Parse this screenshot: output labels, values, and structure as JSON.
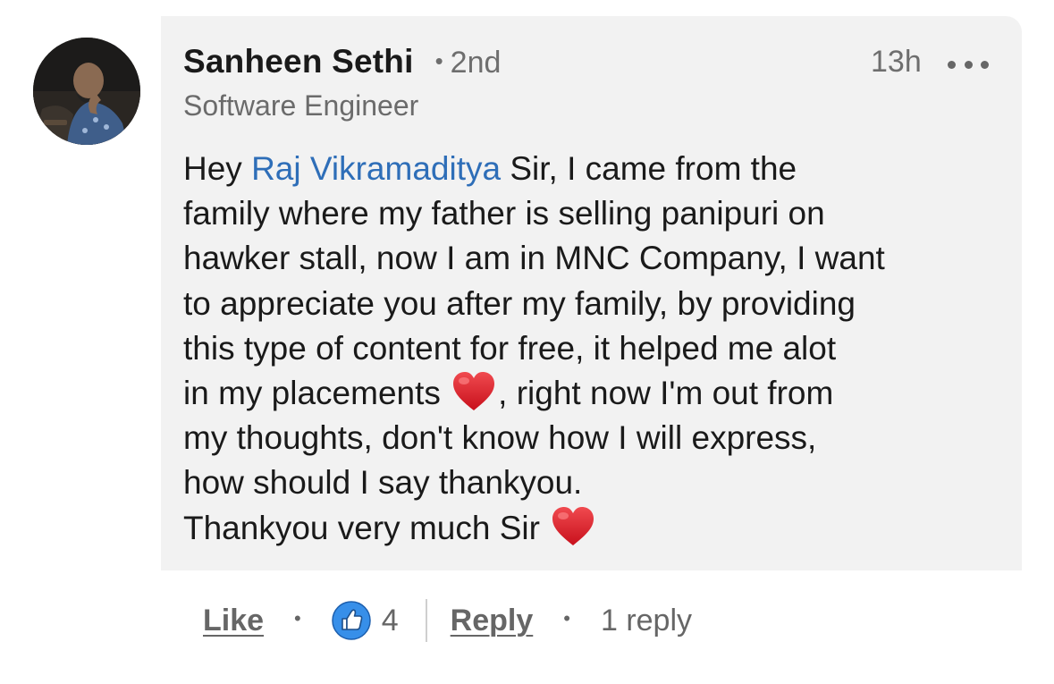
{
  "comment": {
    "author": "Sanheen Sethi",
    "connection_separator": "•",
    "connection_degree": "2nd",
    "headline": "Software Engineer",
    "timestamp": "13h",
    "more_icon": "more-horizontal-icon",
    "body": {
      "line1_before": "Hey ",
      "mention": "Raj Vikramaditya",
      "line1_after": " Sir, I came from the",
      "line2": "family where my father is selling panipuri on",
      "line3": "hawker stall, now I am in MNC Company, I want",
      "line4": "to appreciate you after my family, by providing",
      "line5": "this type of content for free, it helped me alot",
      "line6_before": "in my placements ",
      "line6_after": ", right now I'm out from",
      "line7": "my thoughts, don't know how I will express,",
      "line8": "how should I say thankyou.",
      "line9": "Thankyou very much Sir ",
      "emoji_name": "red-heart-emoji"
    },
    "colors": {
      "bubble": "#f2f2f2",
      "mention": "#2e6eb8",
      "heart": "#e0202b",
      "like_badge": "#378fe9"
    }
  },
  "actions": {
    "like_label": "Like",
    "separator": "•",
    "like_icon": "thumbs-up-icon",
    "reaction_count": "4",
    "reply_label": "Reply",
    "replies_text": "1 reply"
  }
}
